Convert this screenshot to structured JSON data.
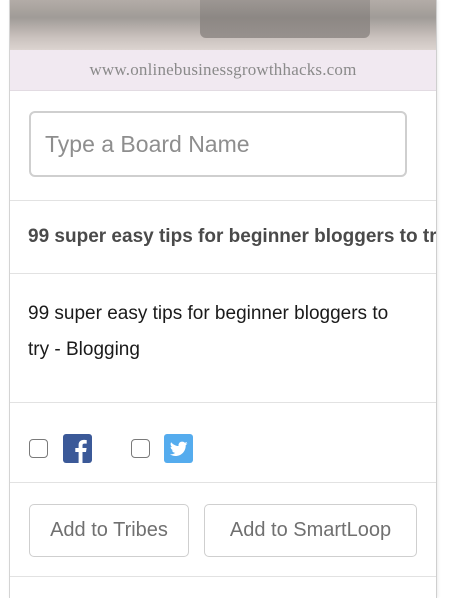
{
  "pin": {
    "watermark": "www.onlinebusinessgrowthhacks.com"
  },
  "board": {
    "placeholder": "Type a Board Name",
    "value": ""
  },
  "pin_title": "99 super easy tips for beginner bloggers to try - Blogging",
  "pin_description": "99 super easy tips for beginner bloggers to try - Blogging",
  "share": {
    "facebook": {
      "icon": "facebook-icon",
      "checked": false,
      "color": "#3b5998"
    },
    "twitter": {
      "icon": "twitter-icon",
      "checked": false,
      "color": "#55acee"
    }
  },
  "actions": {
    "add_to_tribes": "Add to Tribes",
    "add_to_smartloop": "Add to SmartLoop"
  }
}
